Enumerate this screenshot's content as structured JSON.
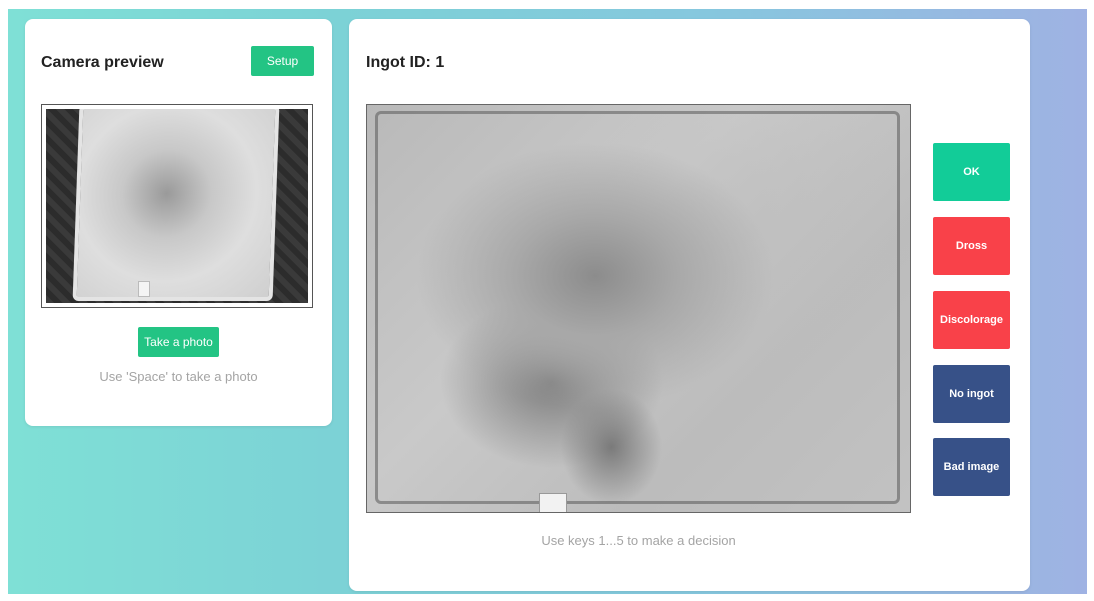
{
  "camera": {
    "title": "Camera preview",
    "setup_label": "Setup",
    "take_photo_label": "Take a photo",
    "hint": "Use 'Space' to take a photo"
  },
  "inspection": {
    "title": "Ingot ID: 1",
    "hint": "Use keys 1...5 to make a decision",
    "decisions": {
      "ok": "OK",
      "dross": "Dross",
      "discolorage": "Discolorage",
      "no_ingot": "No ingot",
      "bad_image": "Bad image"
    }
  },
  "colors": {
    "accent_green": "#23c484",
    "ok": "#12cc98",
    "reject_red": "#f94149",
    "neutral_blue": "#375188"
  }
}
